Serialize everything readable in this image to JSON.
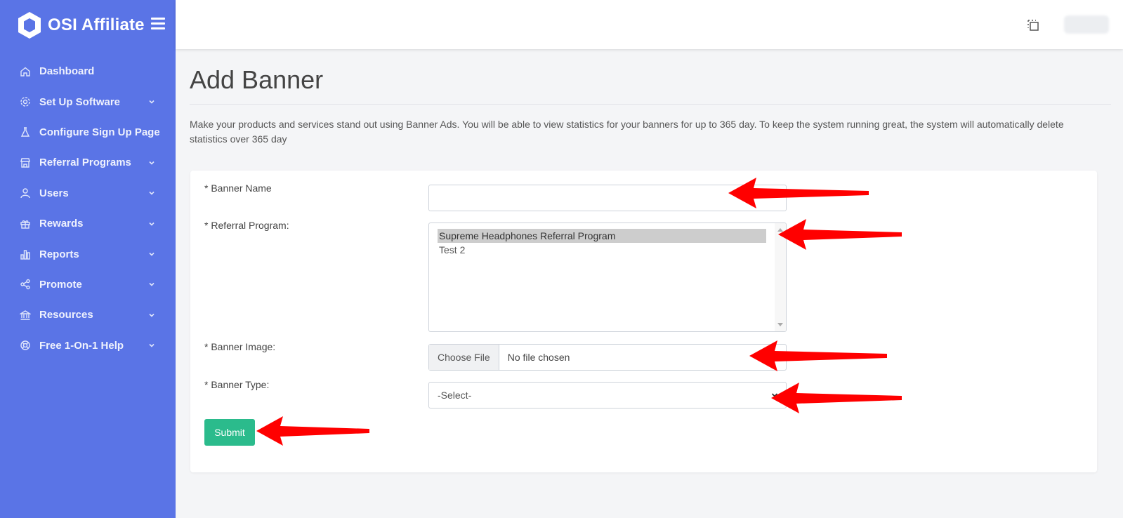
{
  "brand": {
    "name": "OSI Affiliate",
    "logo_icon": "hexagon-logo-icon"
  },
  "sidebar": {
    "items": [
      {
        "label": "Dashboard",
        "icon": "home-icon",
        "has_children": false
      },
      {
        "label": "Set Up Software",
        "icon": "gear-icon",
        "has_children": true
      },
      {
        "label": "Configure Sign Up Page",
        "icon": "flask-icon",
        "has_children": false
      },
      {
        "label": "Referral Programs",
        "icon": "store-icon",
        "has_children": true
      },
      {
        "label": "Users",
        "icon": "user-icon",
        "has_children": true
      },
      {
        "label": "Rewards",
        "icon": "gift-icon",
        "has_children": true
      },
      {
        "label": "Reports",
        "icon": "bar-chart-icon",
        "has_children": true
      },
      {
        "label": "Promote",
        "icon": "share-icon",
        "has_children": true
      },
      {
        "label": "Resources",
        "icon": "bank-icon",
        "has_children": true
      },
      {
        "label": "Free 1-On-1 Help",
        "icon": "lifebuoy-icon",
        "has_children": true
      }
    ]
  },
  "topbar": {
    "icons": [
      "copy-icon"
    ]
  },
  "page": {
    "title": "Add Banner",
    "intro": "Make your products and services stand out using Banner Ads. You will be able to view statistics for your banners for up to 365 day. To keep the system running great, the system will automatically delete statistics over 365 day"
  },
  "form": {
    "banner_name": {
      "label": "* Banner Name",
      "value": ""
    },
    "referral_program": {
      "label": "* Referral Program:",
      "options": [
        "Supreme Headphones Referral Program",
        "Test 2"
      ],
      "selected": "Supreme Headphones Referral Program"
    },
    "banner_image": {
      "label": "* Banner Image:",
      "button": "Choose File",
      "status": "No file chosen"
    },
    "banner_type": {
      "label": "* Banner Type:",
      "value": "-Select-"
    },
    "submit_label": "Submit"
  },
  "colors": {
    "sidebar": "#5a74e6",
    "submit": "#2bbb8c",
    "annotation_arrow": "#ff0000"
  },
  "annotations": {
    "arrow_count": 5,
    "arrow_color": "red"
  }
}
